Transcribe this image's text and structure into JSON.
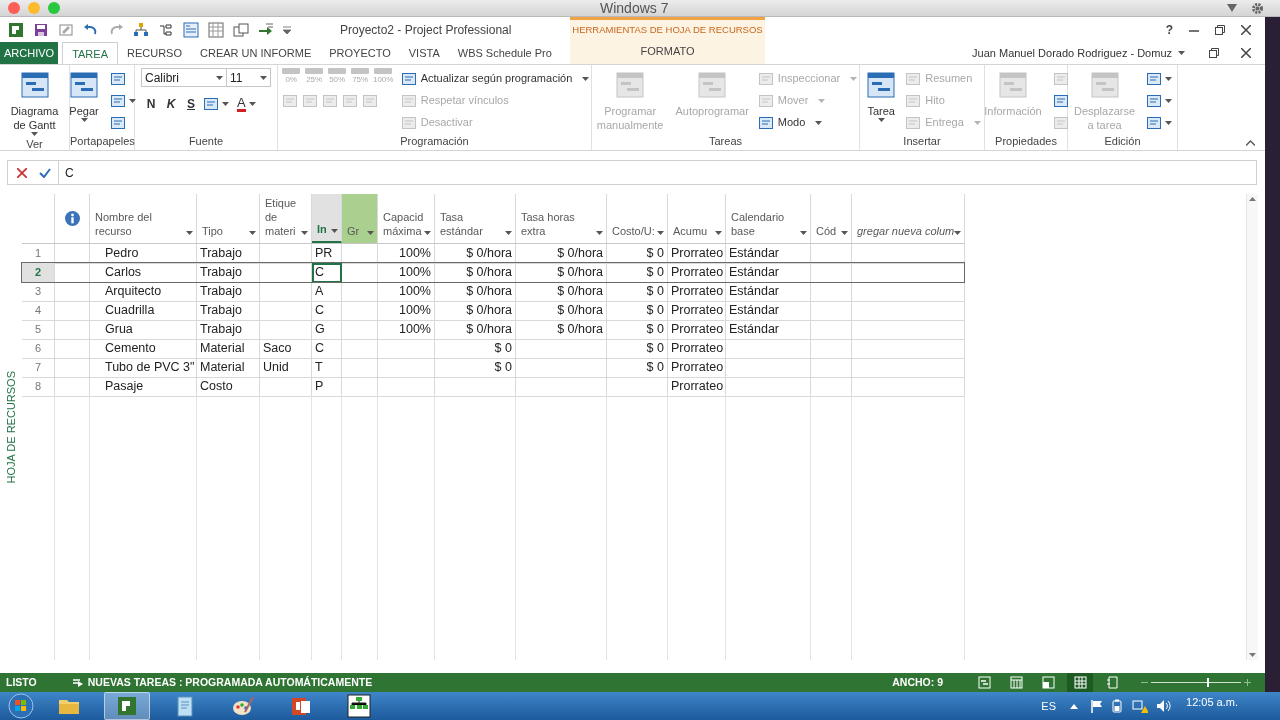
{
  "mac_window": {
    "title": "Windows 7"
  },
  "window": {
    "title": "Proyecto2 - Project Professional",
    "help_button": "?"
  },
  "context_tab_group": {
    "label": "HERRAMIENTAS DE HOJA DE RECURSOS"
  },
  "tabs": [
    {
      "label": "ARCHIVO",
      "kind": "backstage",
      "selected": false
    },
    {
      "label": "TAREA",
      "kind": "tab",
      "selected": true
    },
    {
      "label": "RECURSO",
      "kind": "tab",
      "selected": false
    },
    {
      "label": "CREAR UN INFORME",
      "kind": "tab",
      "selected": false
    },
    {
      "label": "PROYECTO",
      "kind": "tab",
      "selected": false
    },
    {
      "label": "VISTA",
      "kind": "tab",
      "selected": false
    },
    {
      "label": "WBS Schedule Pro",
      "kind": "tab",
      "selected": false
    },
    {
      "label": "FORMATO",
      "kind": "context",
      "selected": false
    }
  ],
  "account": {
    "user": "Juan Manuel Dorado Rodriguez  - Domuz"
  },
  "ribbon": {
    "groups": [
      {
        "label": "Ver",
        "columns": [
          [
            {
              "kind": "large",
              "label": "Diagrama de Gantt",
              "dropdown": true,
              "disabled": false
            }
          ]
        ]
      },
      {
        "label": "Portapapeles",
        "columns": [
          [
            {
              "kind": "large",
              "label": "Pegar",
              "dropdown": true,
              "disabled": false
            }
          ],
          [
            {
              "kind": "icon",
              "dropdown": false,
              "disabled": false
            },
            {
              "kind": "icon",
              "dropdown": true,
              "disabled": false
            },
            {
              "kind": "icon",
              "dropdown": false,
              "disabled": false
            }
          ]
        ]
      },
      {
        "label": "Fuente",
        "columns": [
          [
            {
              "kind": "row",
              "items": [
                {
                  "kind": "combo",
                  "value": "Calibri"
                },
                {
                  "kind": "combo",
                  "value": "11"
                }
              ]
            },
            {
              "kind": "row",
              "items": [
                {
                  "kind": "format",
                  "label": "N"
                },
                {
                  "kind": "format",
                  "label": "K"
                },
                {
                  "kind": "format",
                  "label": "S"
                },
                {
                  "kind": "icon",
                  "dropdown": true,
                  "disabled": false
                },
                {
                  "kind": "color",
                  "label": "A",
                  "dropdown": true,
                  "disabled": false
                }
              ]
            }
          ]
        ]
      },
      {
        "label": "Programación",
        "columns": [
          [
            {
              "kind": "row",
              "items": [
                {
                  "kind": "pct",
                  "label": "0%",
                  "disabled": true
                },
                {
                  "kind": "pct",
                  "label": "25%",
                  "disabled": true
                },
                {
                  "kind": "pct",
                  "label": "50%",
                  "disabled": true
                },
                {
                  "kind": "pct",
                  "label": "75%",
                  "disabled": true
                },
                {
                  "kind": "pct",
                  "label": "100%",
                  "disabled": true
                }
              ]
            },
            {
              "kind": "row",
              "items": [
                {
                  "kind": "icon",
                  "dropdown": false,
                  "disabled": true
                },
                {
                  "kind": "icon",
                  "dropdown": false,
                  "disabled": true
                },
                {
                  "kind": "icon",
                  "dropdown": false,
                  "disabled": true
                },
                {
                  "kind": "icon",
                  "dropdown": false,
                  "disabled": true
                },
                {
                  "kind": "icon",
                  "dropdown": false,
                  "disabled": true
                }
              ]
            }
          ],
          [
            {
              "kind": "small",
              "label": "Actualizar según programación",
              "dropdown": true,
              "disabled": false
            },
            {
              "kind": "small",
              "label": "Respetar vínculos",
              "dropdown": false,
              "disabled": true
            },
            {
              "kind": "small",
              "label": "Desactivar",
              "dropdown": false,
              "disabled": true
            }
          ]
        ]
      },
      {
        "label": "Tareas",
        "columns": [
          [
            {
              "kind": "large",
              "label": "Programar manualmente",
              "dropdown": false,
              "disabled": true
            }
          ],
          [
            {
              "kind": "large",
              "label": "Autoprogramar",
              "dropdown": false,
              "disabled": true
            }
          ],
          [
            {
              "kind": "small",
              "label": "Inspeccionar",
              "dropdown": true,
              "disabled": true
            },
            {
              "kind": "small",
              "label": "Mover",
              "dropdown": true,
              "disabled": true
            },
            {
              "kind": "small",
              "label": "Modo",
              "dropdown": true,
              "disabled": false
            }
          ]
        ]
      },
      {
        "label": "Insertar",
        "columns": [
          [
            {
              "kind": "large",
              "label": "Tarea",
              "dropdown": true,
              "disabled": false
            }
          ],
          [
            {
              "kind": "small",
              "label": "Resumen",
              "dropdown": false,
              "disabled": true
            },
            {
              "kind": "small",
              "label": "Hito",
              "dropdown": false,
              "disabled": true
            },
            {
              "kind": "small",
              "label": "Entrega",
              "dropdown": true,
              "disabled": true
            }
          ]
        ]
      },
      {
        "label": "Propiedades",
        "columns": [
          [
            {
              "kind": "large",
              "label": "Información",
              "dropdown": false,
              "disabled": true
            }
          ],
          [
            {
              "kind": "icon",
              "dropdown": false,
              "disabled": true
            },
            {
              "kind": "icon",
              "dropdown": false,
              "disabled": false
            },
            {
              "kind": "icon",
              "dropdown": false,
              "disabled": true
            }
          ]
        ]
      },
      {
        "label": "Edición",
        "columns": [
          [
            {
              "kind": "large",
              "label": "Desplazarse a tarea",
              "dropdown": false,
              "disabled": true
            }
          ],
          [
            {
              "kind": "icon",
              "dropdown": true,
              "disabled": false
            },
            {
              "kind": "icon",
              "dropdown": true,
              "disabled": false
            },
            {
              "kind": "icon",
              "dropdown": true,
              "disabled": false
            }
          ]
        ]
      }
    ]
  },
  "formula_bar": {
    "value": "C"
  },
  "side_label": "HOJA DE RECURSOS",
  "sheet": {
    "columns": [
      {
        "kind": "info",
        "selected": false,
        "highlighted": false
      },
      {
        "label": "Nombre del recurso",
        "kind": "name",
        "selected": false,
        "highlighted": false
      },
      {
        "label": "Tipo",
        "kind": "text",
        "selected": false,
        "highlighted": false
      },
      {
        "label": "Etique de materi",
        "kind": "text",
        "selected": false,
        "highlighted": false
      },
      {
        "label": "In",
        "kind": "text",
        "selected": true,
        "highlighted": false
      },
      {
        "label": "Gr",
        "kind": "text",
        "selected": false,
        "highlighted": true
      },
      {
        "label": "Capacid máxima",
        "kind": "number",
        "selected": false,
        "highlighted": false
      },
      {
        "label": "Tasa estándar",
        "kind": "number",
        "selected": false,
        "highlighted": false
      },
      {
        "label": "Tasa horas extra",
        "kind": "number",
        "selected": false,
        "highlighted": false
      },
      {
        "label": "Costo/U:",
        "kind": "number",
        "selected": false,
        "highlighted": false
      },
      {
        "label": "Acumu",
        "kind": "text",
        "selected": false,
        "highlighted": false
      },
      {
        "label": "Calendario base",
        "kind": "text",
        "selected": false,
        "highlighted": false
      },
      {
        "label": "Cód",
        "kind": "text",
        "selected": false,
        "highlighted": false
      },
      {
        "label": "gregar nueva colum",
        "kind": "add",
        "selected": false,
        "highlighted": false
      }
    ],
    "rows": [
      {
        "number": "1",
        "selected": false,
        "cells": [
          null,
          "Pedro",
          "Trabajo",
          null,
          "PR",
          null,
          "100%",
          "$ 0/hora",
          "$ 0/hora",
          "$ 0",
          "Prorrateo",
          "Estándar",
          null,
          null
        ]
      },
      {
        "number": "2",
        "selected": true,
        "cells": [
          null,
          "Carlos",
          "Trabajo",
          null,
          "C",
          null,
          "100%",
          "$ 0/hora",
          "$ 0/hora",
          "$ 0",
          "Prorrateo",
          "Estándar",
          null,
          null
        ]
      },
      {
        "number": "3",
        "selected": false,
        "cells": [
          null,
          "Arquitecto",
          "Trabajo",
          null,
          "A",
          null,
          "100%",
          "$ 0/hora",
          "$ 0/hora",
          "$ 0",
          "Prorrateo",
          "Estándar",
          null,
          null
        ]
      },
      {
        "number": "4",
        "selected": false,
        "cells": [
          null,
          "Cuadrilla",
          "Trabajo",
          null,
          "C",
          null,
          "100%",
          "$ 0/hora",
          "$ 0/hora",
          "$ 0",
          "Prorrateo",
          "Estándar",
          null,
          null
        ]
      },
      {
        "number": "5",
        "selected": false,
        "cells": [
          null,
          "Grua",
          "Trabajo",
          null,
          "G",
          null,
          "100%",
          "$ 0/hora",
          "$ 0/hora",
          "$ 0",
          "Prorrateo",
          "Estándar",
          null,
          null
        ]
      },
      {
        "number": "6",
        "selected": false,
        "cells": [
          null,
          "Cemento",
          "Material",
          "Saco",
          "C",
          null,
          null,
          "$ 0",
          null,
          "$ 0",
          "Prorrateo",
          null,
          null,
          null
        ]
      },
      {
        "number": "7",
        "selected": false,
        "cells": [
          null,
          "Tubo de PVC 3\"",
          "Material",
          "Unid",
          "T",
          null,
          null,
          "$ 0",
          null,
          "$ 0",
          "Prorrateo",
          null,
          null,
          null
        ]
      },
      {
        "number": "8",
        "selected": false,
        "cells": [
          null,
          "Pasaje",
          "Costo",
          null,
          "P",
          null,
          null,
          null,
          null,
          null,
          "Prorrateo",
          null,
          null,
          null
        ]
      }
    ]
  },
  "status_bar": {
    "mode": "LISTO",
    "new_tasks": "NUEVAS TAREAS : PROGRAMADA AUTOMÁTICAMENTE",
    "width": "ANCHO: 9",
    "views": [
      {
        "selected": false
      },
      {
        "selected": false
      },
      {
        "selected": false
      },
      {
        "selected": true
      },
      {
        "selected": false
      }
    ],
    "zoom": {
      "level": 0.64
    }
  },
  "taskbar": {
    "apps": [
      {
        "kind": "folder",
        "active": false
      },
      {
        "kind": "project",
        "active": true
      },
      {
        "kind": "notepad",
        "active": false
      },
      {
        "kind": "paint",
        "active": false
      },
      {
        "kind": "powerpoint",
        "active": false
      },
      {
        "kind": "orgchart",
        "active": false
      }
    ],
    "language": "ES",
    "time": "12:05 a.m."
  }
}
